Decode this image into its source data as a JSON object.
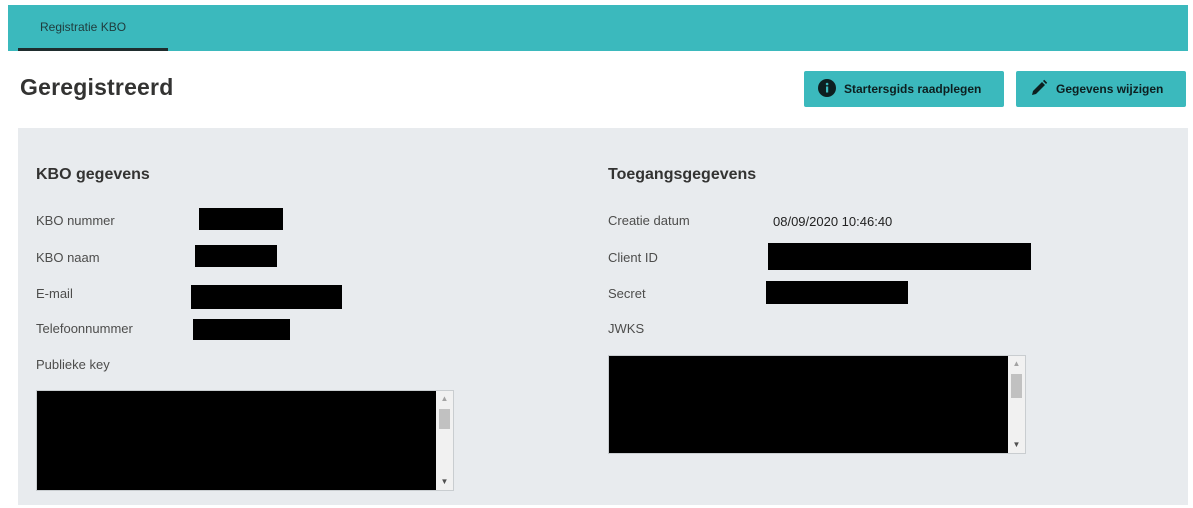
{
  "nav": {
    "tab_label": "Registratie KBO"
  },
  "header": {
    "title": "Geregistreerd",
    "guide_button": "Startersgids raadplegen",
    "edit_button": "Gegevens wijzigen"
  },
  "kbo": {
    "title": "KBO gegevens",
    "number_label": "KBO nummer",
    "name_label": "KBO naam",
    "email_label": "E-mail",
    "phone_label": "Telefoonnummer",
    "public_key_label": "Publieke key"
  },
  "access": {
    "title": "Toegangsgegevens",
    "created_label": "Creatie datum",
    "created_value": "08/09/2020 10:46:40",
    "client_id_label": "Client ID",
    "secret_label": "Secret",
    "jwks_label": "JWKS"
  },
  "colors": {
    "accent": "#3bb9bd",
    "panel": "#e8ebee"
  },
  "icons": {
    "guide": "info-circle-icon",
    "edit": "pencil-icon"
  }
}
